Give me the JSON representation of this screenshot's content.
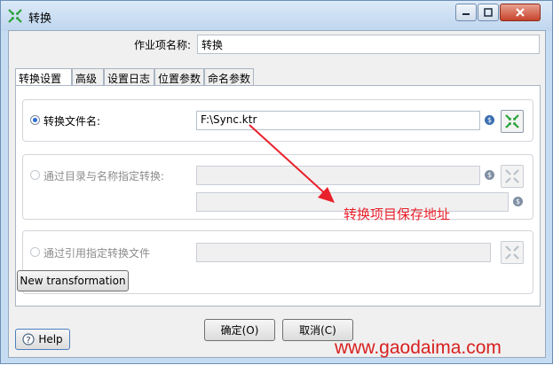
{
  "window": {
    "title": "转换"
  },
  "form": {
    "job_entry_name_label": "作业项名称:",
    "job_entry_name_value": "转换"
  },
  "tabs": [
    {
      "label": "转换设置",
      "active": true
    },
    {
      "label": "高级",
      "active": false
    },
    {
      "label": "设置日志",
      "active": false
    },
    {
      "label": "位置参数",
      "active": false
    },
    {
      "label": "命名参数",
      "active": false
    }
  ],
  "options": {
    "by_filename": {
      "label": "转换文件名:",
      "value": "F:\\Sync.ktr",
      "selected": true
    },
    "by_repository": {
      "label": "通过目录与名称指定转换:",
      "directory_value": "",
      "name_value": "",
      "selected": false
    },
    "by_reference": {
      "label": "通过引用指定转换文件",
      "value": "",
      "selected": false
    }
  },
  "buttons": {
    "new_transformation": "New transformation",
    "ok": "确定(O)",
    "cancel": "取消(C)",
    "help": "Help"
  },
  "annotation": "转换项目保存地址",
  "watermark": "www.gaodaima.com",
  "colors": {
    "accent": "#2d6bd6",
    "annotation": "#e8212b",
    "browse_icon": "#2aa33a"
  }
}
